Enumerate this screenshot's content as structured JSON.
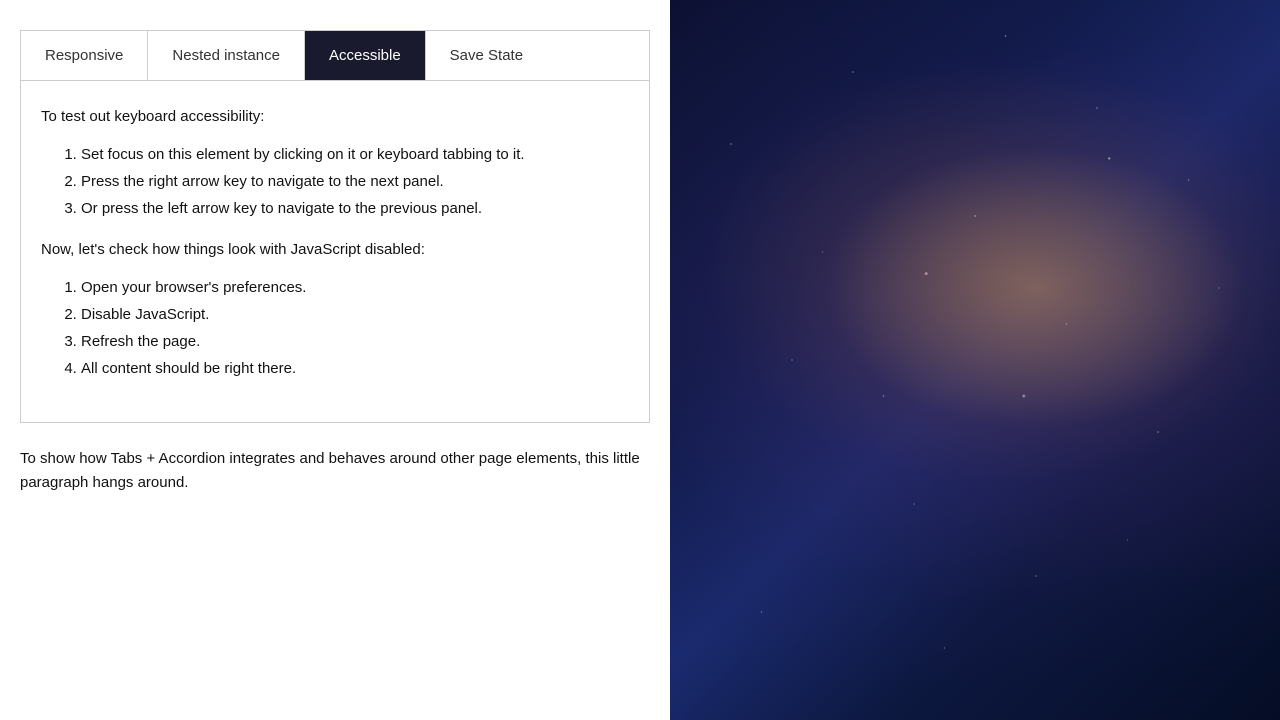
{
  "tabs": [
    {
      "id": "responsive",
      "label": "Responsive",
      "active": false
    },
    {
      "id": "nested-instance",
      "label": "Nested instance",
      "active": false
    },
    {
      "id": "accessible",
      "label": "Accessible",
      "active": true
    },
    {
      "id": "save-state",
      "label": "Save State",
      "active": false
    }
  ],
  "panel": {
    "intro": "To test out keyboard accessibility:",
    "list1": [
      "Set focus on this element by clicking on it or keyboard tabbing to it.",
      "Press the right arrow key to navigate to the next panel.",
      "Or press the left arrow key to navigate to the previous panel."
    ],
    "middle": "Now, let's check how things look with JavaScript disabled:",
    "list2": [
      "Open your browser's preferences.",
      "Disable JavaScript.",
      "Refresh the page.",
      "All content should be right there."
    ]
  },
  "footer": "To show how Tabs + Accordion integrates and behaves around other page elements, this little paragraph hangs around."
}
